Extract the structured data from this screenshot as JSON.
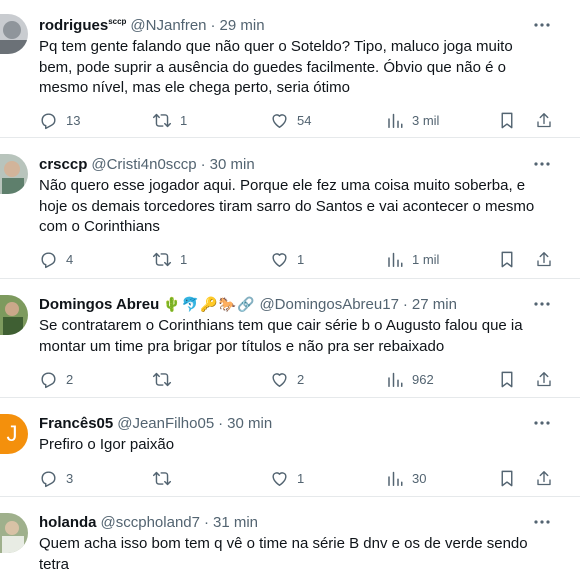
{
  "tweets": [
    {
      "name": "rodrigues",
      "name_sup": "sccp",
      "handle": "@NJanfren",
      "dot": "·",
      "time": "29 min",
      "text": "Pq tem gente falando que não quer o Soteldo? Tipo, maluco joga muito bem, pode suprir a ausência do guedes facilmente. Óbvio que não é o mesmo nível, mas ele chega perto, seria ótimo",
      "replies": "13",
      "retweets": "1",
      "likes": "54",
      "views": "3 mil",
      "avatar_color": "#9aa0a6"
    },
    {
      "name": "crsccp",
      "handle": "@Cristi4n0sccp",
      "dot": "·",
      "time": "30 min",
      "text": "Não quero esse jogador aqui. Porque ele fez uma coisa muito soberba, e hoje os demais torcedores tiram sarro do Santos e vai acontecer o mesmo com o Corinthians",
      "replies": "4",
      "retweets": "1",
      "likes": "1",
      "views": "1 mil",
      "avatar_color": "#6e8a7a"
    },
    {
      "name": "Domingos Abreu",
      "emojis": "🌵🐬🔑🐎🔗",
      "handle": "@DomingosAbreu17",
      "dot": "·",
      "time": "27 min",
      "text": "Se contratarem o Corinthians tem que cair série b o Augusto falou que ia montar um  time pra brigar por títulos e  não pra ser rebaixado",
      "replies": "2",
      "retweets": "",
      "likes": "2",
      "views": "962",
      "avatar_color": "#4f7a3a"
    },
    {
      "name": "Francês05",
      "handle": "@JeanFilho05",
      "dot": "·",
      "time": "30 min",
      "text": "Prefiro o Igor paixão",
      "replies": "3",
      "retweets": "",
      "likes": "1",
      "views": "30",
      "avatar_color": "#f4900c",
      "avatar_letter": "J"
    },
    {
      "name": "holanda",
      "handle": "@sccpholand7",
      "dot": "·",
      "time": "31 min",
      "text": "Quem acha isso bom tem q vê o time na série B dnv e os de verde sendo tetra",
      "avatar_color": "#7a8f6a"
    }
  ],
  "icons": {
    "reply": "reply-icon",
    "retweet": "retweet-icon",
    "like": "like-icon",
    "views": "views-icon",
    "bookmark": "bookmark-icon",
    "share": "share-icon",
    "more": "more-icon"
  },
  "colors": {
    "text": "#0f1419",
    "secondary": "#536471",
    "divider": "#e6e9eb"
  }
}
